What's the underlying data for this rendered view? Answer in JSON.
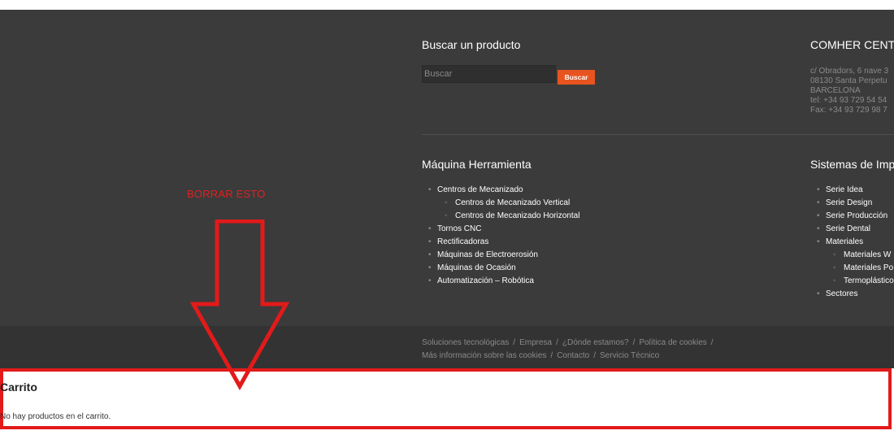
{
  "search": {
    "title": "Buscar un producto",
    "placeholder": "Buscar",
    "button_label": "Buscar"
  },
  "company": {
    "title": "COMHER CENT",
    "address_lines": [
      "c/ Obradors, 6 nave 3",
      "08130 Santa Perpetu",
      "BARCELONA",
      "tel: +34 93 729 54 54",
      "Fax: +34 93 729 98 7"
    ]
  },
  "maquina": {
    "title": "Máquina Herramienta",
    "items": [
      {
        "label": "Centros de Mecanizado",
        "level": 1
      },
      {
        "label": "Centros de Mecanizado Vertical",
        "level": 2
      },
      {
        "label": "Centros de Mecanizado Horizontal",
        "level": 2
      },
      {
        "label": "Tornos CNC",
        "level": 1
      },
      {
        "label": "Rectificadoras",
        "level": 1
      },
      {
        "label": "Máquinas de Electroerosión",
        "level": 1
      },
      {
        "label": "Máquinas de Ocasión",
        "level": 1
      },
      {
        "label": "Automatización – Robótica",
        "level": 1
      }
    ]
  },
  "sistemas": {
    "title": "Sistemas de Imp",
    "items": [
      {
        "label": "Serie Idea",
        "level": 1
      },
      {
        "label": "Serie Design",
        "level": 1
      },
      {
        "label": "Serie Producción",
        "level": 1
      },
      {
        "label": "Serie Dental",
        "level": 1
      },
      {
        "label": "Materiales",
        "level": 1
      },
      {
        "label": "Materiales W",
        "level": 2
      },
      {
        "label": "Materiales Po",
        "level": 2
      },
      {
        "label": "Termoplástico",
        "level": 2
      },
      {
        "label": "Sectores",
        "level": 1
      }
    ]
  },
  "bottom_links": {
    "items": [
      "Soluciones tecnológicas",
      "Empresa",
      "¿Dónde estamos?",
      "Política de cookies",
      "Más información sobre las cookies",
      "Contacto",
      "Servicio Técnico"
    ],
    "separator": "/"
  },
  "annotation": {
    "text": "BORRAR ESTO",
    "color": "#e02020"
  },
  "cart": {
    "title": "Carrito",
    "empty_message": "No hay productos en el carrito."
  },
  "colors": {
    "footer_bg": "#3b3b3b",
    "bottom_bar_bg": "#333333",
    "accent": "#e8541f",
    "annotation_red": "#e21a1a"
  },
  "icons": {
    "bullet": "•",
    "sub_bullet": "◦"
  }
}
